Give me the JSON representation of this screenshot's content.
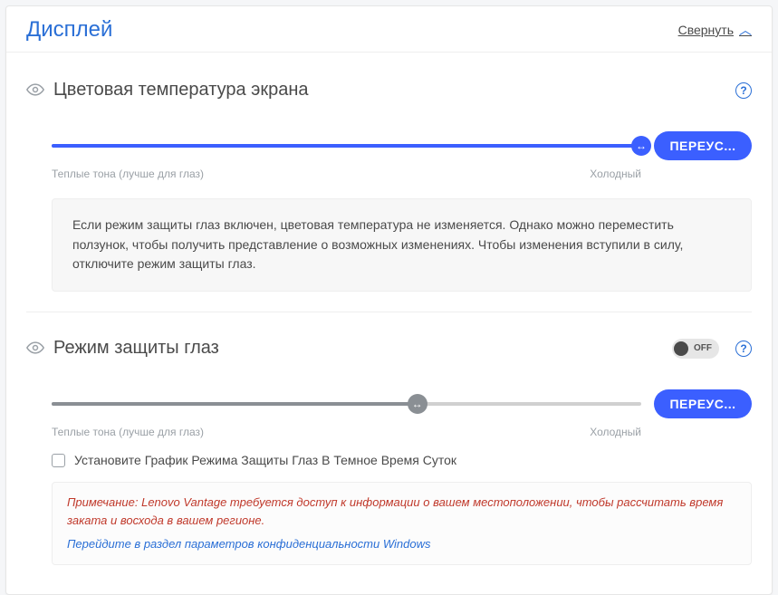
{
  "header": {
    "title": "Дисплей",
    "collapse": "Свернуть"
  },
  "sections": {
    "color_temp": {
      "title": "Цветовая температура экрана",
      "slider": {
        "warm_label": "Теплые тона (лучше для глаз)",
        "cold_label": "Холодный",
        "position_pct": 100
      },
      "reset_button": "ПЕРЕУС...",
      "info": "Если режим защиты глаз включен, цветовая температура не изменяется. Однако можно переместить ползунок, чтобы получить представление о возможных изменениях. Чтобы изменения вступили в силу, отключите режим защиты глаз."
    },
    "eye_care": {
      "title": "Режим защиты глаз",
      "toggle_state": "OFF",
      "slider": {
        "warm_label": "Теплые тона (лучше для глаз)",
        "cold_label": "Холодный",
        "position_pct": 62
      },
      "reset_button": "ПЕРЕУС...",
      "checkbox_label": "Установите График Режима Защиты Глаз В Темное Время Суток",
      "notice_text": "Примечание: Lenovo Vantage требуется доступ к информации о вашем местоположении, чтобы рассчитать время заката и восхода в вашем регионе.",
      "notice_link": "Перейдите в раздел параметров конфиденциальности Windows"
    }
  }
}
